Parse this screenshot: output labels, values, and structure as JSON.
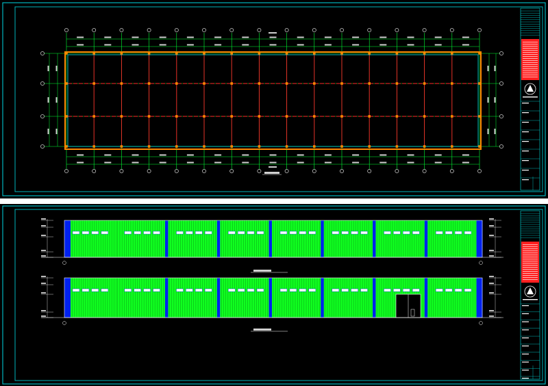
{
  "sheets": [
    {
      "id": "plan",
      "kind": "floor-plan",
      "bays": 15,
      "grid_rows": 4,
      "colors": {
        "frame": "#00b5bd",
        "grid": "#00ff33",
        "wall": "#ff8800",
        "beam": "#ff2a2a",
        "column": "#ff8800"
      }
    },
    {
      "id": "elevations",
      "kind": "elevation",
      "panels": 8,
      "colors": {
        "cladding": "#10ff20",
        "column_band": "#0022ee",
        "frame": "#00b5bd"
      },
      "views": [
        {
          "id": "elevation-1",
          "has_door": false
        },
        {
          "id": "elevation-2",
          "has_door": true
        }
      ]
    }
  ],
  "title_block": {
    "colors": {
      "red_block": "#ff2020",
      "text": "#ffffff"
    }
  }
}
